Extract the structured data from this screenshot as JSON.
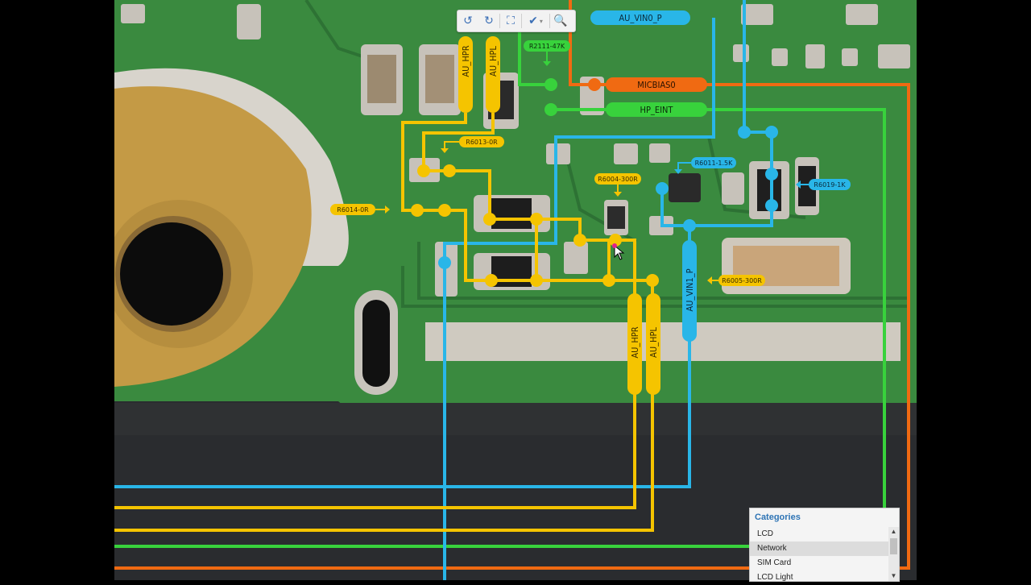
{
  "toolbar": {
    "buttons": [
      {
        "name": "rotate-left-icon",
        "glyph": "↺"
      },
      {
        "name": "rotate-right-icon",
        "glyph": "↻"
      },
      {
        "name": "fit-screen-icon",
        "glyph": "⛶"
      },
      {
        "name": "highlight-tool-icon",
        "glyph": "✔"
      },
      {
        "name": "search-icon",
        "glyph": "🔍"
      }
    ]
  },
  "nets": {
    "au_vin0_p": "AU_VIN0_P",
    "micbias0": "MICBIAS0",
    "hp_eint": "HP_EINT",
    "au_hpr_top": "AU_HPR",
    "au_hpl_top": "AU_HPL",
    "au_hpr_bottom": "AU_HPR",
    "au_hpl_bottom": "AU_HPL",
    "au_vin1_p": "AU_VIN1_P"
  },
  "components": {
    "r2111": "R2111-47K",
    "r6013": "R6013-0R",
    "r6014": "R6014-0R",
    "r6004": "R6004-300R",
    "r6011": "R6011-1.5K",
    "r6019": "R6019-1K",
    "r6005": "R6005-300R"
  },
  "categories": {
    "title": "Categories",
    "items": [
      "LCD",
      "Network",
      "SIM Card",
      "LCD Light"
    ],
    "selected": "Network"
  },
  "colors": {
    "board": "#2f7a3a",
    "au_vin_blue": "#29b6e8",
    "micbias_orange": "#f06a12",
    "hp_eint_green": "#38d23c",
    "au_hp_yellow": "#f5c400"
  }
}
